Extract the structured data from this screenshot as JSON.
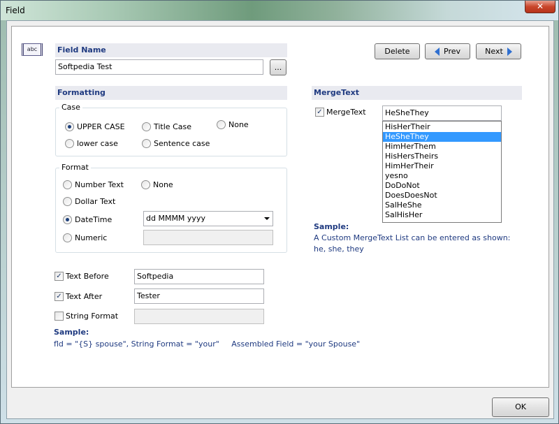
{
  "window": {
    "title": "Field",
    "close_symbol": "✕"
  },
  "field_name": {
    "header": "Field Name",
    "value": "Softpedia Test",
    "browse_label": "..."
  },
  "nav": {
    "delete_label": "Delete",
    "prev_label": "Prev",
    "next_label": "Next"
  },
  "formatting": {
    "header": "Formatting",
    "case": {
      "title": "Case",
      "options": [
        {
          "label": "UPPER CASE",
          "selected": true
        },
        {
          "label": "Title Case",
          "selected": false
        },
        {
          "label": "None",
          "selected": false
        },
        {
          "label": "lower case",
          "selected": false
        },
        {
          "label": "Sentence case",
          "selected": false
        }
      ]
    },
    "format": {
      "title": "Format",
      "options": [
        {
          "label": "Number Text",
          "selected": false
        },
        {
          "label": "None",
          "selected": false
        },
        {
          "label": "Dollar Text",
          "selected": false
        },
        {
          "label": "DateTime",
          "selected": true
        },
        {
          "label": "Numeric",
          "selected": false
        }
      ],
      "datetime_value": "dd MMMM yyyy",
      "numeric_value": ""
    }
  },
  "text_options": {
    "text_before": {
      "label": "Text Before",
      "checked": true,
      "value": "Softpedia"
    },
    "text_after": {
      "label": "Text After",
      "checked": true,
      "value": "Tester"
    },
    "string_format": {
      "label": "String Format",
      "checked": false,
      "value": ""
    }
  },
  "sample_bottom": {
    "label": "Sample:",
    "text": "fld = \"{S} spouse\", String Format = \"your\"     Assembled Field = \"your Spouse\""
  },
  "merge_text": {
    "header": "MergeText",
    "checkbox_label": "MergeText",
    "checked": true,
    "value": "HeSheThey",
    "list": [
      "HisHerTheir",
      "HeSheThey",
      "HimHerThem",
      "HisHersTheirs",
      "HimHerTheir",
      "yesno",
      "DoDoNot",
      "DoesDoesNot",
      "SalHeShe",
      "SalHisHer"
    ],
    "selected": "HeSheThey",
    "sample_label": "Sample:",
    "sample_text_1": "A Custom MergeText List can be entered as shown:",
    "sample_text_2": "he, she, they"
  },
  "footer": {
    "ok_label": "OK"
  },
  "icons": {
    "field_icon": "abc"
  }
}
